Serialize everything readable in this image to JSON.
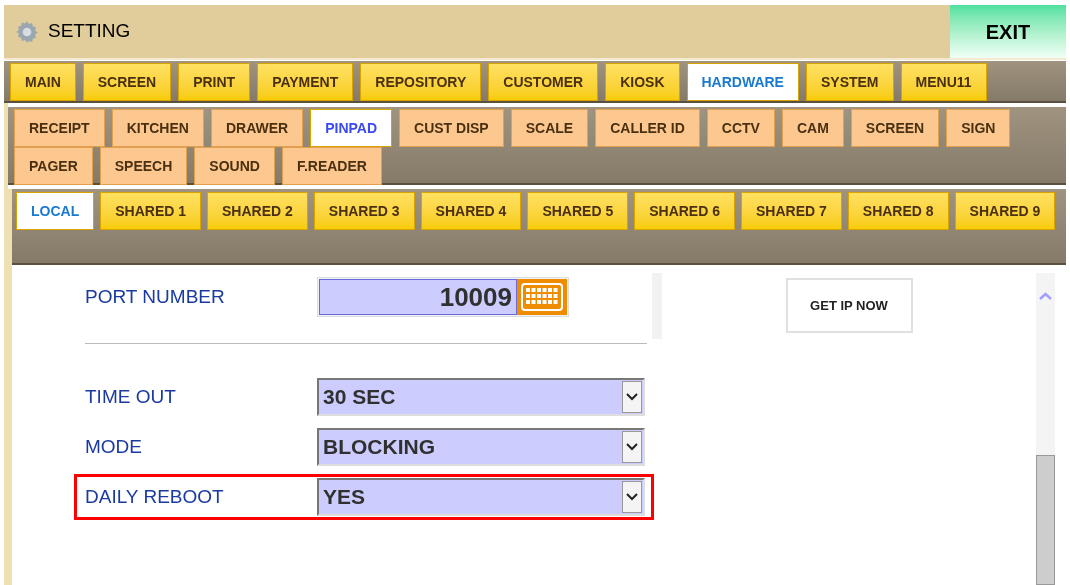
{
  "header": {
    "title": "SETTING",
    "exit_button": "EXIT"
  },
  "main_tabs": [
    {
      "label": "MAIN",
      "selected": false
    },
    {
      "label": "SCREEN",
      "selected": false
    },
    {
      "label": "PRINT",
      "selected": false
    },
    {
      "label": "PAYMENT",
      "selected": false
    },
    {
      "label": "REPOSITORY",
      "selected": false
    },
    {
      "label": "CUSTOMER",
      "selected": false
    },
    {
      "label": "KIOSK",
      "selected": false
    },
    {
      "label": "HARDWARE",
      "selected": true
    },
    {
      "label": "SYSTEM",
      "selected": false
    },
    {
      "label": "MENU11",
      "selected": false
    }
  ],
  "hardware_tabs": [
    {
      "label": "RECEIPT",
      "selected": false
    },
    {
      "label": "KITCHEN",
      "selected": false
    },
    {
      "label": "DRAWER",
      "selected": false
    },
    {
      "label": "PINPAD",
      "selected": true
    },
    {
      "label": "CUST DISP",
      "selected": false
    },
    {
      "label": "SCALE",
      "selected": false
    },
    {
      "label": "CALLER ID",
      "selected": false
    },
    {
      "label": "CCTV",
      "selected": false
    },
    {
      "label": "CAM",
      "selected": false
    },
    {
      "label": "SCREEN",
      "selected": false
    },
    {
      "label": "SIGN",
      "selected": false
    },
    {
      "label": "PAGER",
      "selected": false
    },
    {
      "label": "SPEECH",
      "selected": false
    },
    {
      "label": "SOUND",
      "selected": false
    },
    {
      "label": "F.READER",
      "selected": false
    }
  ],
  "device_tabs": [
    {
      "label": "LOCAL",
      "selected": true
    },
    {
      "label": "SHARED 1",
      "selected": false
    },
    {
      "label": "SHARED 2",
      "selected": false
    },
    {
      "label": "SHARED 3",
      "selected": false
    },
    {
      "label": "SHARED 4",
      "selected": false
    },
    {
      "label": "SHARED 5",
      "selected": false
    },
    {
      "label": "SHARED 6",
      "selected": false
    },
    {
      "label": "SHARED 7",
      "selected": false
    },
    {
      "label": "SHARED 8",
      "selected": false
    },
    {
      "label": "SHARED 9",
      "selected": false
    }
  ],
  "port": {
    "label": "PORT NUMBER",
    "value": "10009"
  },
  "get_ip_button": "GET IP NOW",
  "settings": [
    {
      "label": "TIME OUT",
      "value": "30 SEC",
      "highlighted": false
    },
    {
      "label": "MODE",
      "value": "BLOCKING",
      "highlighted": false
    },
    {
      "label": "DAILY REBOOT",
      "value": "YES",
      "highlighted": true
    }
  ]
}
